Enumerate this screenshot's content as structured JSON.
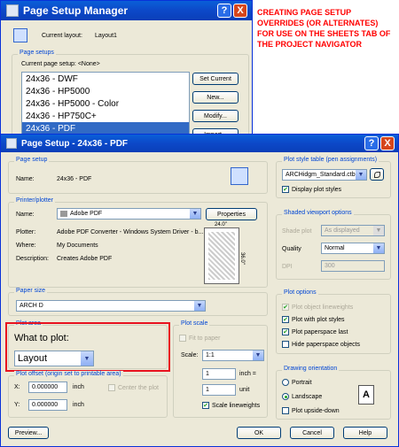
{
  "annotation": "CREATING PAGE SETUP OVERRIDES (OR ALTERNATES) FOR USE ON THE SHEETS TAB OF THE PROJECT NAVIGATOR",
  "manager": {
    "title": "Page Setup Manager",
    "current_layout_label": "Current layout:",
    "current_layout_value": "Layout1",
    "page_setups_group": "Page setups",
    "current_page_setup": "Current page setup:  <None>",
    "list": [
      "24x36 - DWF",
      "24x36 - HP5000",
      "24x36 - HP5000 - Color",
      "24x36 - HP750C+",
      "24x36 - PDF"
    ],
    "selected_index": 4,
    "buttons": {
      "set_current": "Set Current",
      "new": "New...",
      "modify": "Modify...",
      "import": "Import..."
    },
    "help_btn": "?",
    "close_btn": "X"
  },
  "setup": {
    "title": "Page Setup - 24x36 - PDF",
    "help_btn": "?",
    "close_btn": "X",
    "page_setup_group": "Page setup",
    "name_label": "Name:",
    "name_value": "24x36 - PDF",
    "printer_group": "Printer/plotter",
    "printer_name_label": "Name:",
    "printer_name_value": "Adobe PDF",
    "properties_btn": "Properties",
    "plotter_label": "Plotter:",
    "plotter_value": "Adobe PDF Converter - Windows System Driver - b...",
    "where_label": "Where:",
    "where_value": "My Documents",
    "description_label": "Description:",
    "description_value": "Creates Adobe PDF",
    "preview_width": "24.0\"",
    "preview_height": "36.0\"",
    "paper_group": "Paper size",
    "paper_value": "ARCH D",
    "plot_area_group": "Plot area",
    "what_to_plot_label": "What to plot:",
    "what_to_plot_value": "Layout",
    "offset_group": "Plot offset (origin set to printable area)",
    "x_label": "X:",
    "x_value": "0.000000",
    "x_unit": "inch",
    "y_label": "Y:",
    "y_value": "0.000000",
    "y_unit": "inch",
    "center_plot": "Center the plot",
    "scale_group": "Plot scale",
    "fit_to_paper": "Fit to paper",
    "scale_label": "Scale:",
    "scale_value": "1:1",
    "scale_num": "1",
    "scale_num_unit": "inch =",
    "scale_den": "1",
    "scale_den_unit": "unit",
    "scale_lineweights": "Scale lineweights",
    "pst_group": "Plot style table (pen assignments)",
    "pst_value": "ARCHidgm_Standard.ctb",
    "display_plot_styles": "Display plot styles",
    "shaded_group": "Shaded viewport options",
    "shade_plot_label": "Shade plot",
    "shade_plot_value": "As displayed",
    "quality_label": "Quality",
    "quality_value": "Normal",
    "dpi_label": "DPI",
    "dpi_value": "300",
    "options_group": "Plot options",
    "opt_lineweights": "Plot object lineweights",
    "opt_plot_styles": "Plot with plot styles",
    "opt_paperspace_last": "Plot paperspace last",
    "opt_hide": "Hide paperspace objects",
    "orientation_group": "Drawing orientation",
    "portrait": "Portrait",
    "landscape": "Landscape",
    "upside_down": "Plot upside-down",
    "orientation_icon": "A",
    "preview_btn": "Preview...",
    "ok_btn": "OK",
    "cancel_btn": "Cancel",
    "help_footer_btn": "Help"
  },
  "colors": {
    "annotation": "#ff0000",
    "highlight": "#e8121f",
    "selection": "#316ac5",
    "group_label": "#0046d5"
  }
}
